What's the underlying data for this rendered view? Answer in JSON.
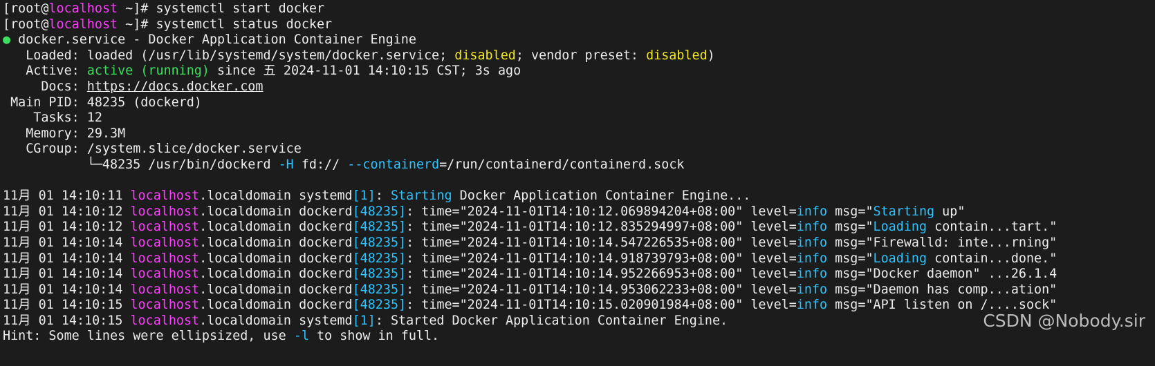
{
  "colors": {
    "background": "#1c1c1c",
    "text": "#ececec",
    "host_magenta": "#ff3cff",
    "pid_cyan": "#2bc4ff",
    "active_green": "#3bde5f",
    "disabled_yellow": "#f2e81e"
  },
  "terminal": {
    "lines": [
      [
        {
          "t": "[root@",
          "c": "default"
        },
        {
          "t": "localhost",
          "c": "magenta"
        },
        {
          "t": " ~]# systemctl start docker",
          "c": "default"
        }
      ],
      [
        {
          "t": "[root@",
          "c": "default"
        },
        {
          "t": "localhost",
          "c": "magenta"
        },
        {
          "t": " ~]# systemctl status docker",
          "c": "default"
        }
      ],
      [
        {
          "t": "● ",
          "c": "green"
        },
        {
          "t": "docker.service - Docker Application Container Engine",
          "c": "default"
        }
      ],
      [
        {
          "t": "   Loaded: loaded (/usr/lib/systemd/system/docker.service; ",
          "c": "default"
        },
        {
          "t": "disabled",
          "c": "yellow"
        },
        {
          "t": "; vendor preset: ",
          "c": "default"
        },
        {
          "t": "disabled",
          "c": "yellow"
        },
        {
          "t": ")",
          "c": "default"
        }
      ],
      [
        {
          "t": "   Active: ",
          "c": "default"
        },
        {
          "t": "active (running)",
          "c": "green"
        },
        {
          "t": " since 五 2024-11-01 14:10:15 CST; 3s ago",
          "c": "default"
        }
      ],
      [
        {
          "t": "     Docs: ",
          "c": "default"
        },
        {
          "t": "https://docs.docker.com",
          "c": "default",
          "link": true
        }
      ],
      [
        {
          "t": " Main PID: 48235 (dockerd)",
          "c": "default"
        }
      ],
      [
        {
          "t": "    Tasks: 12",
          "c": "default"
        }
      ],
      [
        {
          "t": "   Memory: 29.3M",
          "c": "default"
        }
      ],
      [
        {
          "t": "   CGroup: /system.slice/docker.service",
          "c": "default"
        }
      ],
      [
        {
          "t": "           └─48235 /usr/bin/dockerd ",
          "c": "default"
        },
        {
          "t": "-H",
          "c": "cyan"
        },
        {
          "t": " fd:// ",
          "c": "default"
        },
        {
          "t": "--containerd",
          "c": "cyan"
        },
        {
          "t": "=/run/containerd/containerd.sock",
          "c": "default"
        }
      ],
      [],
      [
        {
          "t": "11月 01 14:10:11 ",
          "c": "default"
        },
        {
          "t": "localhost",
          "c": "magenta"
        },
        {
          "t": ".localdomain systemd",
          "c": "default"
        },
        {
          "t": "[1]",
          "c": "cyan"
        },
        {
          "t": ": ",
          "c": "default"
        },
        {
          "t": "Starting",
          "c": "cyan"
        },
        {
          "t": " Docker Application Container Engine...",
          "c": "default"
        }
      ],
      [
        {
          "t": "11月 01 14:10:12 ",
          "c": "default"
        },
        {
          "t": "localhost",
          "c": "magenta"
        },
        {
          "t": ".localdomain dockerd",
          "c": "default"
        },
        {
          "t": "[48235]",
          "c": "cyan"
        },
        {
          "t": ": time=\"2024-11-01T14:10:12.069894204+08:00\" level=",
          "c": "default"
        },
        {
          "t": "info",
          "c": "cyan"
        },
        {
          "t": " msg=\"",
          "c": "default"
        },
        {
          "t": "Starting",
          "c": "cyan"
        },
        {
          "t": " up\"",
          "c": "default"
        }
      ],
      [
        {
          "t": "11月 01 14:10:12 ",
          "c": "default"
        },
        {
          "t": "localhost",
          "c": "magenta"
        },
        {
          "t": ".localdomain dockerd",
          "c": "default"
        },
        {
          "t": "[48235]",
          "c": "cyan"
        },
        {
          "t": ": time=\"2024-11-01T14:10:12.835294997+08:00\" level=",
          "c": "default"
        },
        {
          "t": "info",
          "c": "cyan"
        },
        {
          "t": " msg=\"",
          "c": "default"
        },
        {
          "t": "Loading",
          "c": "cyan"
        },
        {
          "t": " contain...tart.\"",
          "c": "default"
        }
      ],
      [
        {
          "t": "11月 01 14:10:14 ",
          "c": "default"
        },
        {
          "t": "localhost",
          "c": "magenta"
        },
        {
          "t": ".localdomain dockerd",
          "c": "default"
        },
        {
          "t": "[48235]",
          "c": "cyan"
        },
        {
          "t": ": time=\"2024-11-01T14:10:14.547226535+08:00\" level=",
          "c": "default"
        },
        {
          "t": "info",
          "c": "cyan"
        },
        {
          "t": " msg=\"Firewalld: inte...rning\"",
          "c": "default"
        }
      ],
      [
        {
          "t": "11月 01 14:10:14 ",
          "c": "default"
        },
        {
          "t": "localhost",
          "c": "magenta"
        },
        {
          "t": ".localdomain dockerd",
          "c": "default"
        },
        {
          "t": "[48235]",
          "c": "cyan"
        },
        {
          "t": ": time=\"2024-11-01T14:10:14.918739793+08:00\" level=",
          "c": "default"
        },
        {
          "t": "info",
          "c": "cyan"
        },
        {
          "t": " msg=\"",
          "c": "default"
        },
        {
          "t": "Loading",
          "c": "cyan"
        },
        {
          "t": " contain...done.\"",
          "c": "default"
        }
      ],
      [
        {
          "t": "11月 01 14:10:14 ",
          "c": "default"
        },
        {
          "t": "localhost",
          "c": "magenta"
        },
        {
          "t": ".localdomain dockerd",
          "c": "default"
        },
        {
          "t": "[48235]",
          "c": "cyan"
        },
        {
          "t": ": time=\"2024-11-01T14:10:14.952266953+08:00\" level=",
          "c": "default"
        },
        {
          "t": "info",
          "c": "cyan"
        },
        {
          "t": " msg=\"Docker daemon\" ...26.1.4",
          "c": "default"
        }
      ],
      [
        {
          "t": "11月 01 14:10:14 ",
          "c": "default"
        },
        {
          "t": "localhost",
          "c": "magenta"
        },
        {
          "t": ".localdomain dockerd",
          "c": "default"
        },
        {
          "t": "[48235]",
          "c": "cyan"
        },
        {
          "t": ": time=\"2024-11-01T14:10:14.953062233+08:00\" level=",
          "c": "default"
        },
        {
          "t": "info",
          "c": "cyan"
        },
        {
          "t": " msg=\"Daemon has comp...ation\"",
          "c": "default"
        }
      ],
      [
        {
          "t": "11月 01 14:10:15 ",
          "c": "default"
        },
        {
          "t": "localhost",
          "c": "magenta"
        },
        {
          "t": ".localdomain dockerd",
          "c": "default"
        },
        {
          "t": "[48235]",
          "c": "cyan"
        },
        {
          "t": ": time=\"2024-11-01T14:10:15.020901984+08:00\" level=",
          "c": "default"
        },
        {
          "t": "info",
          "c": "cyan"
        },
        {
          "t": " msg=\"API listen on /....sock\"",
          "c": "default"
        }
      ],
      [
        {
          "t": "11月 01 14:10:15 ",
          "c": "default"
        },
        {
          "t": "localhost",
          "c": "magenta"
        },
        {
          "t": ".localdomain systemd",
          "c": "default"
        },
        {
          "t": "[1]",
          "c": "cyan"
        },
        {
          "t": ": Started Docker Application Container Engine.",
          "c": "default"
        }
      ],
      [
        {
          "t": "Hint: Some lines were ellipsized, use ",
          "c": "default"
        },
        {
          "t": "-l",
          "c": "cyan"
        },
        {
          "t": " to show in full.",
          "c": "default"
        }
      ]
    ]
  },
  "watermark": "CSDN @Nobody.sir"
}
